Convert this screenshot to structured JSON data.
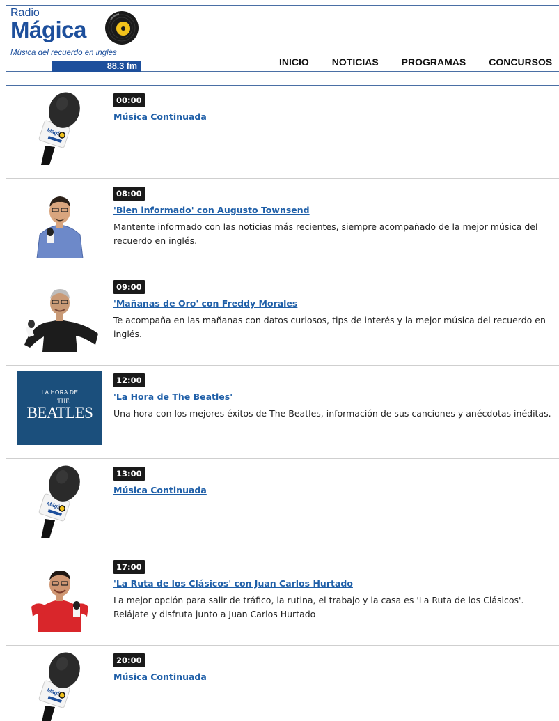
{
  "header": {
    "logo": {
      "radio": "Radio",
      "magica": "Mágica",
      "tagline": "Música del recuerdo en inglés",
      "frequency": "88.3 fm"
    },
    "nav": [
      {
        "label": "INICIO"
      },
      {
        "label": "NOTICIAS"
      },
      {
        "label": "PROGRAMAS"
      },
      {
        "label": "CONCURSOS"
      }
    ]
  },
  "schedule": [
    {
      "time": "00:00",
      "title": "Música Continuada",
      "description": "",
      "thumb": "microphone-logo"
    },
    {
      "time": "08:00",
      "title": "'Bien informado' con Augusto Townsend",
      "description": "Mantente informado con las noticias más recientes, siempre acompañado de la mejor música del recuerdo en inglés.",
      "thumb": "host-photo"
    },
    {
      "time": "09:00",
      "title": "'Mañanas de Oro' con Freddy Morales",
      "description": "Te acompaña en las mañanas con datos curiosos, tips de interés y la mejor música del recuerdo en inglés.",
      "thumb": "host-photo"
    },
    {
      "time": "12:00",
      "title": "'La Hora de The Beatles'",
      "description": "Una hora con los mejores éxitos de The Beatles, información de sus canciones y anécdotas inéditas.",
      "thumb": "beatles-banner",
      "thumb_text_top": "LA HORA DE",
      "thumb_text_the": "THE",
      "thumb_text_main": "BEATLES"
    },
    {
      "time": "13:00",
      "title": "Música Continuada",
      "description": "",
      "thumb": "microphone-logo"
    },
    {
      "time": "17:00",
      "title": "'La Ruta de los Clásicos' con Juan Carlos Hurtado",
      "description": "La mejor opción para salir de tráfico, la rutina, el trabajo y la casa es 'La Ruta de los Clásicos'. Relájate y disfruta junto a Juan Carlos Hurtado",
      "thumb": "host-photo"
    },
    {
      "time": "20:00",
      "title": "Música Continuada",
      "description": "",
      "thumb": "microphone-logo"
    }
  ],
  "colors": {
    "brand_blue": "#1d4f9c",
    "link_blue": "#1f5fa8",
    "beatles_bg": "#1b4f7c",
    "disc_yellow": "#f2c21b"
  }
}
